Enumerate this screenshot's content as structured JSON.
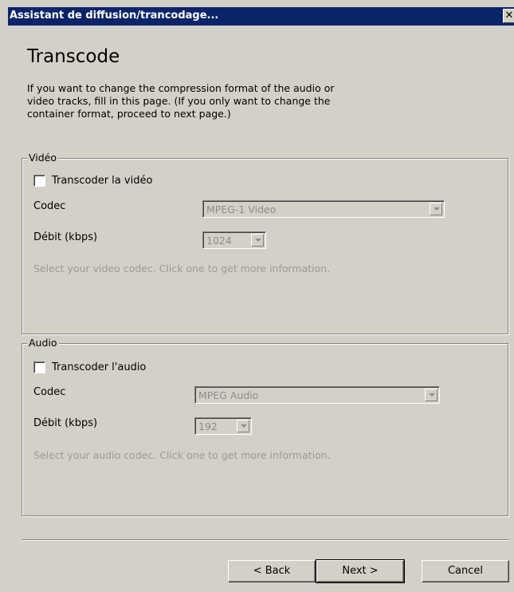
{
  "window": {
    "title": "Assistant de diffusion/trancodage...",
    "close_glyph": "✕"
  },
  "page": {
    "heading": "Transcode",
    "description": "If you want to change the compression format of the audio or video tracks, fill in this page. (If you only want to change the container format, proceed to next page.)"
  },
  "video": {
    "legend": "Vidéo",
    "checkbox_label": "Transcoder la vidéo",
    "codec_label": "Codec",
    "codec_value": "MPEG-1 Video",
    "bitrate_label": "Débit (kbps)",
    "bitrate_value": "1024",
    "help": "Select your video codec. Click one to get more information."
  },
  "audio": {
    "legend": "Audio",
    "checkbox_label": "Transcoder l'audio",
    "codec_label": "Codec",
    "codec_value": "MPEG Audio",
    "bitrate_label": "Débit (kbps)",
    "bitrate_value": "192",
    "help": "Select your audio codec. Click one to get more information."
  },
  "buttons": {
    "back": "< Back",
    "next": "Next >",
    "cancel": "Cancel"
  },
  "icons": {
    "close": "close-icon",
    "dropdown": "chevron-down-icon"
  },
  "colors": {
    "titlebar": "#0a246a",
    "dialog": "#d4d0c8",
    "disabled_text": "#8c8c8c"
  }
}
